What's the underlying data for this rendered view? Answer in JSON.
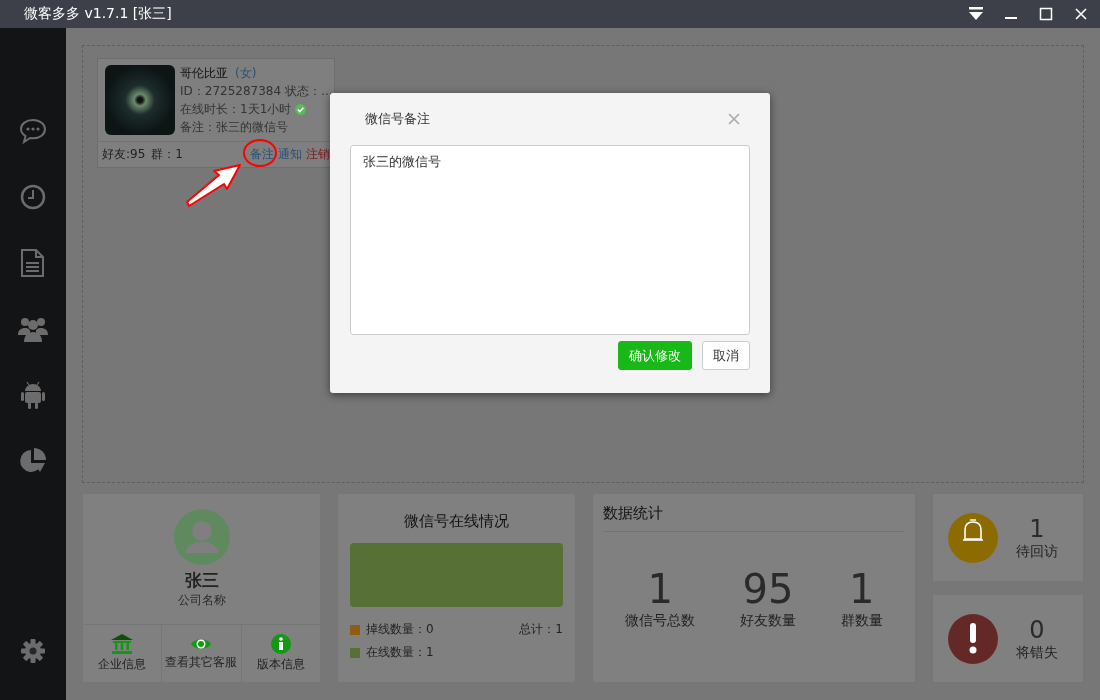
{
  "window": {
    "title": "微客多多 v1.7.1 [张三]"
  },
  "accounts": [
    {
      "name": "哥伦比亚",
      "gender": "(女)",
      "id": "ID：2725287384",
      "status": "状态：...",
      "online_time": "在线时长：1天1小时",
      "online": true,
      "note": "备注：张三的微信号",
      "friends": "好友:95",
      "groups": "群：1",
      "actions": [
        {
          "label": "备注",
          "kind": "note",
          "circled": true
        },
        {
          "label": "通知",
          "kind": "notify",
          "circled": false
        },
        {
          "label": "注销",
          "kind": "logout",
          "circled": false
        }
      ]
    }
  ],
  "profile": {
    "name": "张三",
    "company": "公司名称",
    "buttons": [
      {
        "label": "企业信息",
        "kind": "company"
      },
      {
        "label": "查看其它客服",
        "kind": "others"
      },
      {
        "label": "版本信息",
        "kind": "version"
      }
    ]
  },
  "online_panel": {
    "title": "微信号在线情况",
    "legend": [
      {
        "label": "掉线数量：0",
        "color": "#8f5c12"
      },
      {
        "label": "在线数量：1",
        "color": "#577035"
      }
    ],
    "total": "总计：1"
  },
  "stats": {
    "title": "数据统计",
    "items": [
      {
        "value": "1",
        "label": "微信号总数"
      },
      {
        "value": "95",
        "label": "好友数量"
      },
      {
        "value": "1",
        "label": "群数量"
      }
    ]
  },
  "alerts": [
    {
      "value": "1",
      "label": "待回访",
      "kind": "revisit",
      "color": "#8c6c00"
    },
    {
      "value": "0",
      "label": "将错失",
      "kind": "miss",
      "color": "#642826"
    }
  ],
  "dialog": {
    "title": "微信号备注",
    "note": "张三的微信号",
    "buttons": [
      {
        "label": "确认修改",
        "kind": "primary"
      },
      {
        "label": "取消",
        "kind": "default"
      }
    ]
  }
}
